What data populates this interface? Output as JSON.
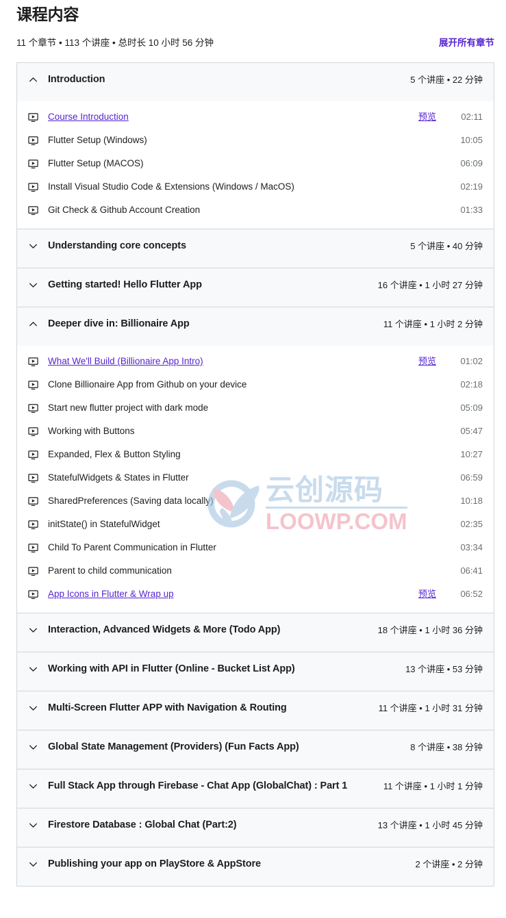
{
  "header": {
    "title": "课程内容",
    "summary": "11 个章节 • 113 个讲座 • 总时长 10 小时 56 分钟",
    "expand_all_label": "展开所有章节",
    "accent_color": "#5624d0"
  },
  "icons": {
    "chevron_up": "chevron-up-icon",
    "chevron_down": "chevron-down-icon",
    "video": "video-icon"
  },
  "labels": {
    "preview": "预览"
  },
  "watermark": {
    "cn_text": "云创源码",
    "en_text": "LOOWP.COM",
    "cn_color": "#a8c6e3",
    "en_color": "#efa0ad"
  },
  "sections": [
    {
      "title": "Introduction",
      "meta": "5 个讲座 • 22 分钟",
      "expanded": true,
      "lectures": [
        {
          "title": "Course Introduction",
          "duration": "02:11",
          "is_link": true,
          "preview": true
        },
        {
          "title": "Flutter Setup (Windows)",
          "duration": "10:05",
          "is_link": false,
          "preview": false
        },
        {
          "title": "Flutter Setup (MACOS)",
          "duration": "06:09",
          "is_link": false,
          "preview": false
        },
        {
          "title": "Install Visual Studio Code & Extensions (Windows / MacOS)",
          "duration": "02:19",
          "is_link": false,
          "preview": false
        },
        {
          "title": "Git Check & Github Account Creation",
          "duration": "01:33",
          "is_link": false,
          "preview": false
        }
      ]
    },
    {
      "title": "Understanding core concepts",
      "meta": "5 个讲座 • 40 分钟",
      "expanded": false,
      "lectures": []
    },
    {
      "title": "Getting started! Hello Flutter App",
      "meta": "16 个讲座 • 1 小时 27 分钟",
      "expanded": false,
      "lectures": []
    },
    {
      "title": "Deeper dive in: Billionaire App",
      "meta": "11 个讲座 • 1 小时 2 分钟",
      "expanded": true,
      "lectures": [
        {
          "title": "What We'll Build (Billionaire App Intro)",
          "duration": "01:02",
          "is_link": true,
          "preview": true
        },
        {
          "title": "Clone Billionaire App from Github on your device",
          "duration": "02:18",
          "is_link": false,
          "preview": false
        },
        {
          "title": "Start new flutter project with dark mode",
          "duration": "05:09",
          "is_link": false,
          "preview": false
        },
        {
          "title": "Working with Buttons",
          "duration": "05:47",
          "is_link": false,
          "preview": false
        },
        {
          "title": "Expanded, Flex & Button Styling",
          "duration": "10:27",
          "is_link": false,
          "preview": false
        },
        {
          "title": "StatefulWidgets & States in Flutter",
          "duration": "06:59",
          "is_link": false,
          "preview": false
        },
        {
          "title": "SharedPreferences (Saving data locally)",
          "duration": "10:18",
          "is_link": false,
          "preview": false
        },
        {
          "title": "initState() in StatefulWidget",
          "duration": "02:35",
          "is_link": false,
          "preview": false
        },
        {
          "title": "Child To Parent Communication in Flutter",
          "duration": "03:34",
          "is_link": false,
          "preview": false
        },
        {
          "title": "Parent to child communication",
          "duration": "06:41",
          "is_link": false,
          "preview": false
        },
        {
          "title": "App Icons in Flutter & Wrap up",
          "duration": "06:52",
          "is_link": true,
          "preview": true
        }
      ]
    },
    {
      "title": "Interaction, Advanced Widgets & More (Todo App)",
      "meta": "18 个讲座 • 1 小时 36 分钟",
      "expanded": false,
      "lectures": []
    },
    {
      "title": "Working with API in Flutter (Online - Bucket List App)",
      "meta": "13 个讲座 • 53 分钟",
      "expanded": false,
      "lectures": []
    },
    {
      "title": "Multi-Screen Flutter APP with Navigation & Routing",
      "meta": "11 个讲座 • 1 小时 31 分钟",
      "expanded": false,
      "lectures": []
    },
    {
      "title": "Global State Management (Providers) (Fun Facts App)",
      "meta": "8 个讲座 • 38 分钟",
      "expanded": false,
      "lectures": []
    },
    {
      "title": "Full Stack App through Firebase - Chat App (GlobalChat) : Part 1",
      "meta": "11 个讲座 • 1 小时 1 分钟",
      "expanded": false,
      "lectures": []
    },
    {
      "title": "Firestore Database : Global Chat (Part:2)",
      "meta": "13 个讲座 • 1 小时 45 分钟",
      "expanded": false,
      "lectures": []
    },
    {
      "title": "Publishing your app on PlayStore & AppStore",
      "meta": "2 个讲座 • 2 分钟",
      "expanded": false,
      "lectures": []
    }
  ]
}
